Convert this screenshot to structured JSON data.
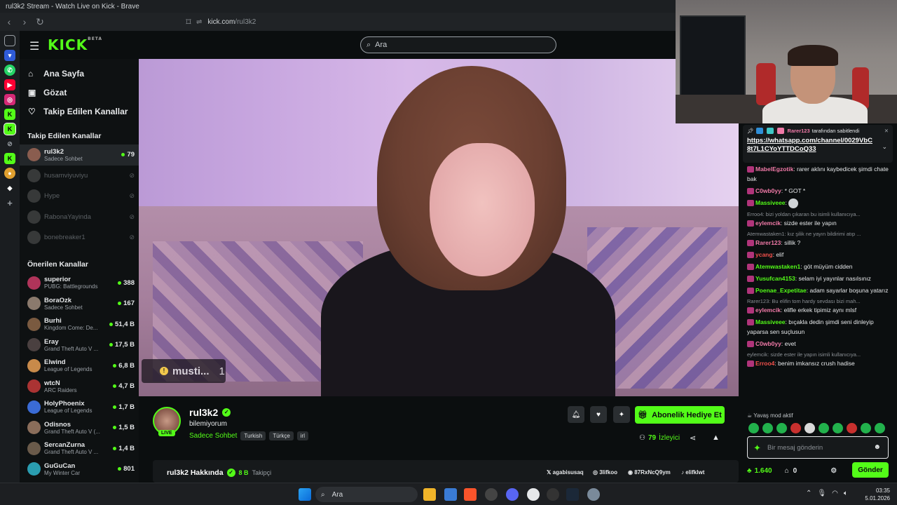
{
  "window": {
    "title": "rul3k2 Stream - Watch Live on Kick - Brave"
  },
  "browser": {
    "url_domain": "kick.com",
    "url_path": "/rul3k2"
  },
  "header": {
    "logo": "KICK",
    "logo_beta": "BETA",
    "search_placeholder": "Ara"
  },
  "nav": {
    "home": "Ana Sayfa",
    "browse": "Gözat",
    "following": "Takip Edilen Kanallar"
  },
  "followed": {
    "title": "Takip Edilen Kanallar",
    "channels": [
      {
        "name": "rul3k2",
        "sub": "Sadece Sohbet",
        "viewers": "79",
        "live": true
      },
      {
        "name": "husamviyuviyu",
        "live": false
      },
      {
        "name": "Hype",
        "live": false
      },
      {
        "name": "RabonaYayinda",
        "live": false
      },
      {
        "name": "bonebreaker1",
        "live": false
      }
    ]
  },
  "recommended": {
    "title": "Önerilen Kanallar",
    "channels": [
      {
        "name": "superior",
        "sub": "PUBG: Battlegrounds",
        "viewers": "388"
      },
      {
        "name": "BoraOzk",
        "sub": "Sadece Sohbet",
        "viewers": "167"
      },
      {
        "name": "Burhi",
        "sub": "Kingdom Come: De...",
        "viewers": "51,4 B"
      },
      {
        "name": "Eray",
        "sub": "Grand Theft Auto V ...",
        "viewers": "17,5 B"
      },
      {
        "name": "Elwind",
        "sub": "League of Legends",
        "viewers": "6,8 B"
      },
      {
        "name": "wtcN",
        "sub": "ARC Raiders",
        "viewers": "4,7 B"
      },
      {
        "name": "HolyPhoenix",
        "sub": "League of Legends",
        "viewers": "1,7 B"
      },
      {
        "name": "Odisnos",
        "sub": "Grand Theft Auto V (...",
        "viewers": "1,5 B"
      },
      {
        "name": "SercanZurna",
        "sub": "Grand Theft Auto V ...",
        "viewers": "1,4 B"
      },
      {
        "name": "GuGuCan",
        "sub": "My Winter Car",
        "viewers": "801"
      }
    ]
  },
  "video": {
    "badge_name": "musti...",
    "badge_count": "1"
  },
  "stream": {
    "name": "rul3k2",
    "live_label": "LIVE",
    "title": "bilemiyorum",
    "category": "Sadece Sohbet",
    "tags": [
      "Turkish",
      "Türkçe",
      "irl"
    ],
    "subscribe_label": "Abonelik Hediye Et",
    "viewers": "79",
    "viewers_label": "İzleyici"
  },
  "about": {
    "title": "rul3k2 Hakkında",
    "followers": "8 B",
    "followers_label": "Takipçi",
    "socials": [
      "agabisusaq",
      "3lifkoo",
      "87RxNcQ9ym",
      "elifklwt"
    ]
  },
  "chat": {
    "pinned_by": "Rarer123",
    "pinned_suffix": "tarafından sabitlendi",
    "pinned_link": "https://whatsapp.com/channel/0029VbC8t7L1CYoYTTDCoQ33",
    "messages": [
      {
        "user": "MabelEgzotik",
        "color": "#f17aa8",
        "text": "rarer aklını kaybedicek şimdi chate bak"
      },
      {
        "user": "C0wb0yy",
        "color": "#f17aa8",
        "text": "* GOT *"
      },
      {
        "user": "Massiveee",
        "color": "#53fc18",
        "text": ""
      },
      {
        "reply": "Erroo4: bizi yoldan çıkaran bu isimli kullanıcıya...",
        "user": "eylemcik",
        "color": "#f17aa8",
        "text": "sizde ester ile yapın"
      },
      {
        "reply": "Atemwastaken1: kız şilik ne yayın bildirimi atıp ...",
        "user": "Rarer123",
        "color": "#f17aa8",
        "text": "sillik ?"
      },
      {
        "user": "ycang",
        "color": "#f2504b",
        "text": "elif"
      },
      {
        "user": "Atemwastaken1",
        "color": "#53fc18",
        "text": "göt müyüm cidden"
      },
      {
        "user": "Yusufcan4153",
        "color": "#53fc18",
        "text": "selam iyi yayınlar nasılsınız"
      },
      {
        "user": "Poenae_Expetitae",
        "color": "#53fc18",
        "text": "adam sayarlar boşuna yatarız"
      },
      {
        "reply": "Rarer123: Bu elifin tom hardy sevdası bizi mah...",
        "user": "eylemcik",
        "color": "#f17aa8",
        "text": "elifle erkek tipimiz aynı mlsf"
      },
      {
        "user": "Massiveee",
        "color": "#53fc18",
        "text": "bıçakla dedin şimdi seni dinleyip yaparsa sen suçlusun"
      },
      {
        "user": "C0wb0yy",
        "color": "#f17aa8",
        "text": "evet"
      },
      {
        "reply": "eylemcik: sizde ester ile yapın isimli kullanıcıya...",
        "user": "Erroo4",
        "color": "#f2504b",
        "text": "benim imkansız crush hadise"
      }
    ],
    "slow_mode": "Yavaş mod aktif",
    "input_placeholder": "Bir mesaj gönderin",
    "points": "1.640",
    "items": "0",
    "send_label": "Gönder"
  },
  "taskbar": {
    "search": "Ara",
    "time": "03:35",
    "date": "5.01.2026"
  }
}
